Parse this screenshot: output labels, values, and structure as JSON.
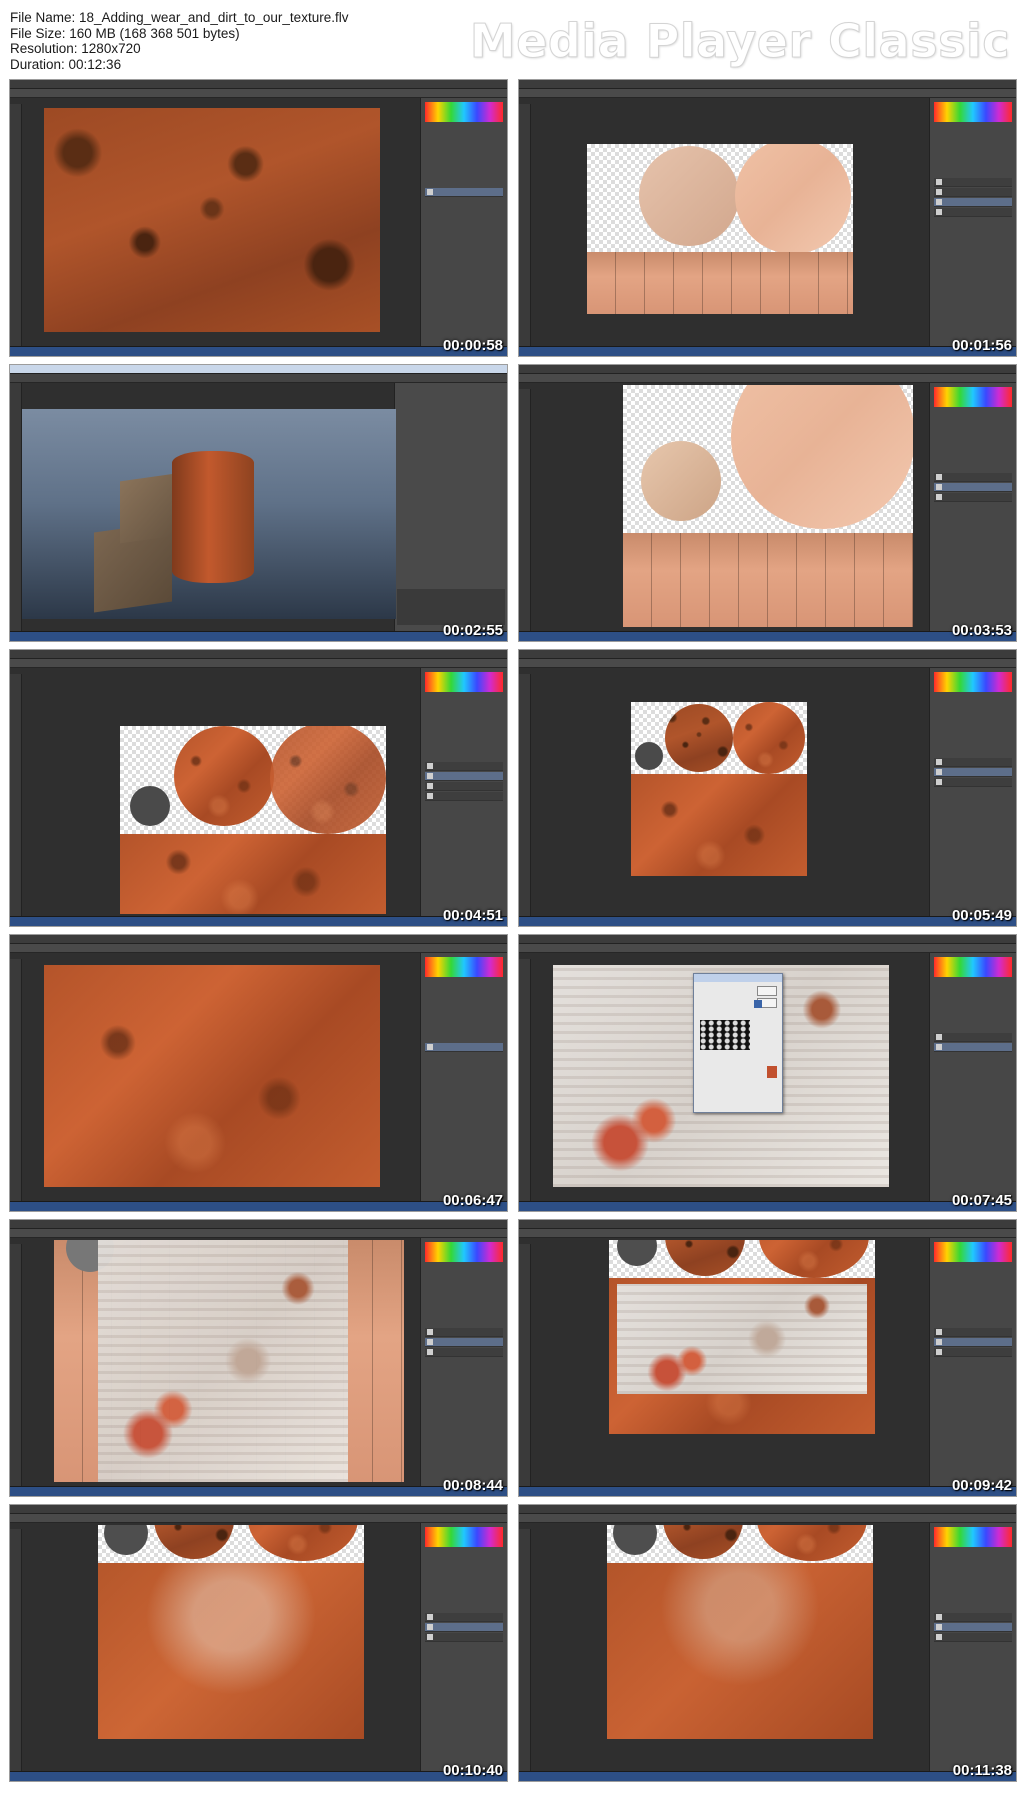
{
  "header": {
    "file_name": "File Name: 18_Adding_wear_and_dirt_to_our_texture.flv",
    "file_size": "File Size: 160 MB (168 368 501 bytes)",
    "resolution": "Resolution: 1280x720",
    "duration": "Duration: 00:12:36",
    "brand": "Media Player Classic"
  },
  "thumbnails": [
    {
      "timestamp": "00:00:58",
      "scene": "rust-texture-closeup"
    },
    {
      "timestamp": "00:01:56",
      "scene": "uv-layout-pale"
    },
    {
      "timestamp": "00:02:55",
      "scene": "3d-viewport-barrel-crates"
    },
    {
      "timestamp": "00:03:53",
      "scene": "uv-layout-zoomed"
    },
    {
      "timestamp": "00:04:51",
      "scene": "uv-layout-rust-discs"
    },
    {
      "timestamp": "00:05:49",
      "scene": "uv-layout-small"
    },
    {
      "timestamp": "00:06:47",
      "scene": "rust-fill-texture"
    },
    {
      "timestamp": "00:07:45",
      "scene": "peeling-paint-dialog"
    },
    {
      "timestamp": "00:08:44",
      "scene": "peeling-paint-over-uv"
    },
    {
      "timestamp": "00:09:42",
      "scene": "peeling-paint-band"
    },
    {
      "timestamp": "00:10:40",
      "scene": "rust-blended-band"
    },
    {
      "timestamp": "00:11:38",
      "scene": "rust-blended-band-final"
    }
  ]
}
